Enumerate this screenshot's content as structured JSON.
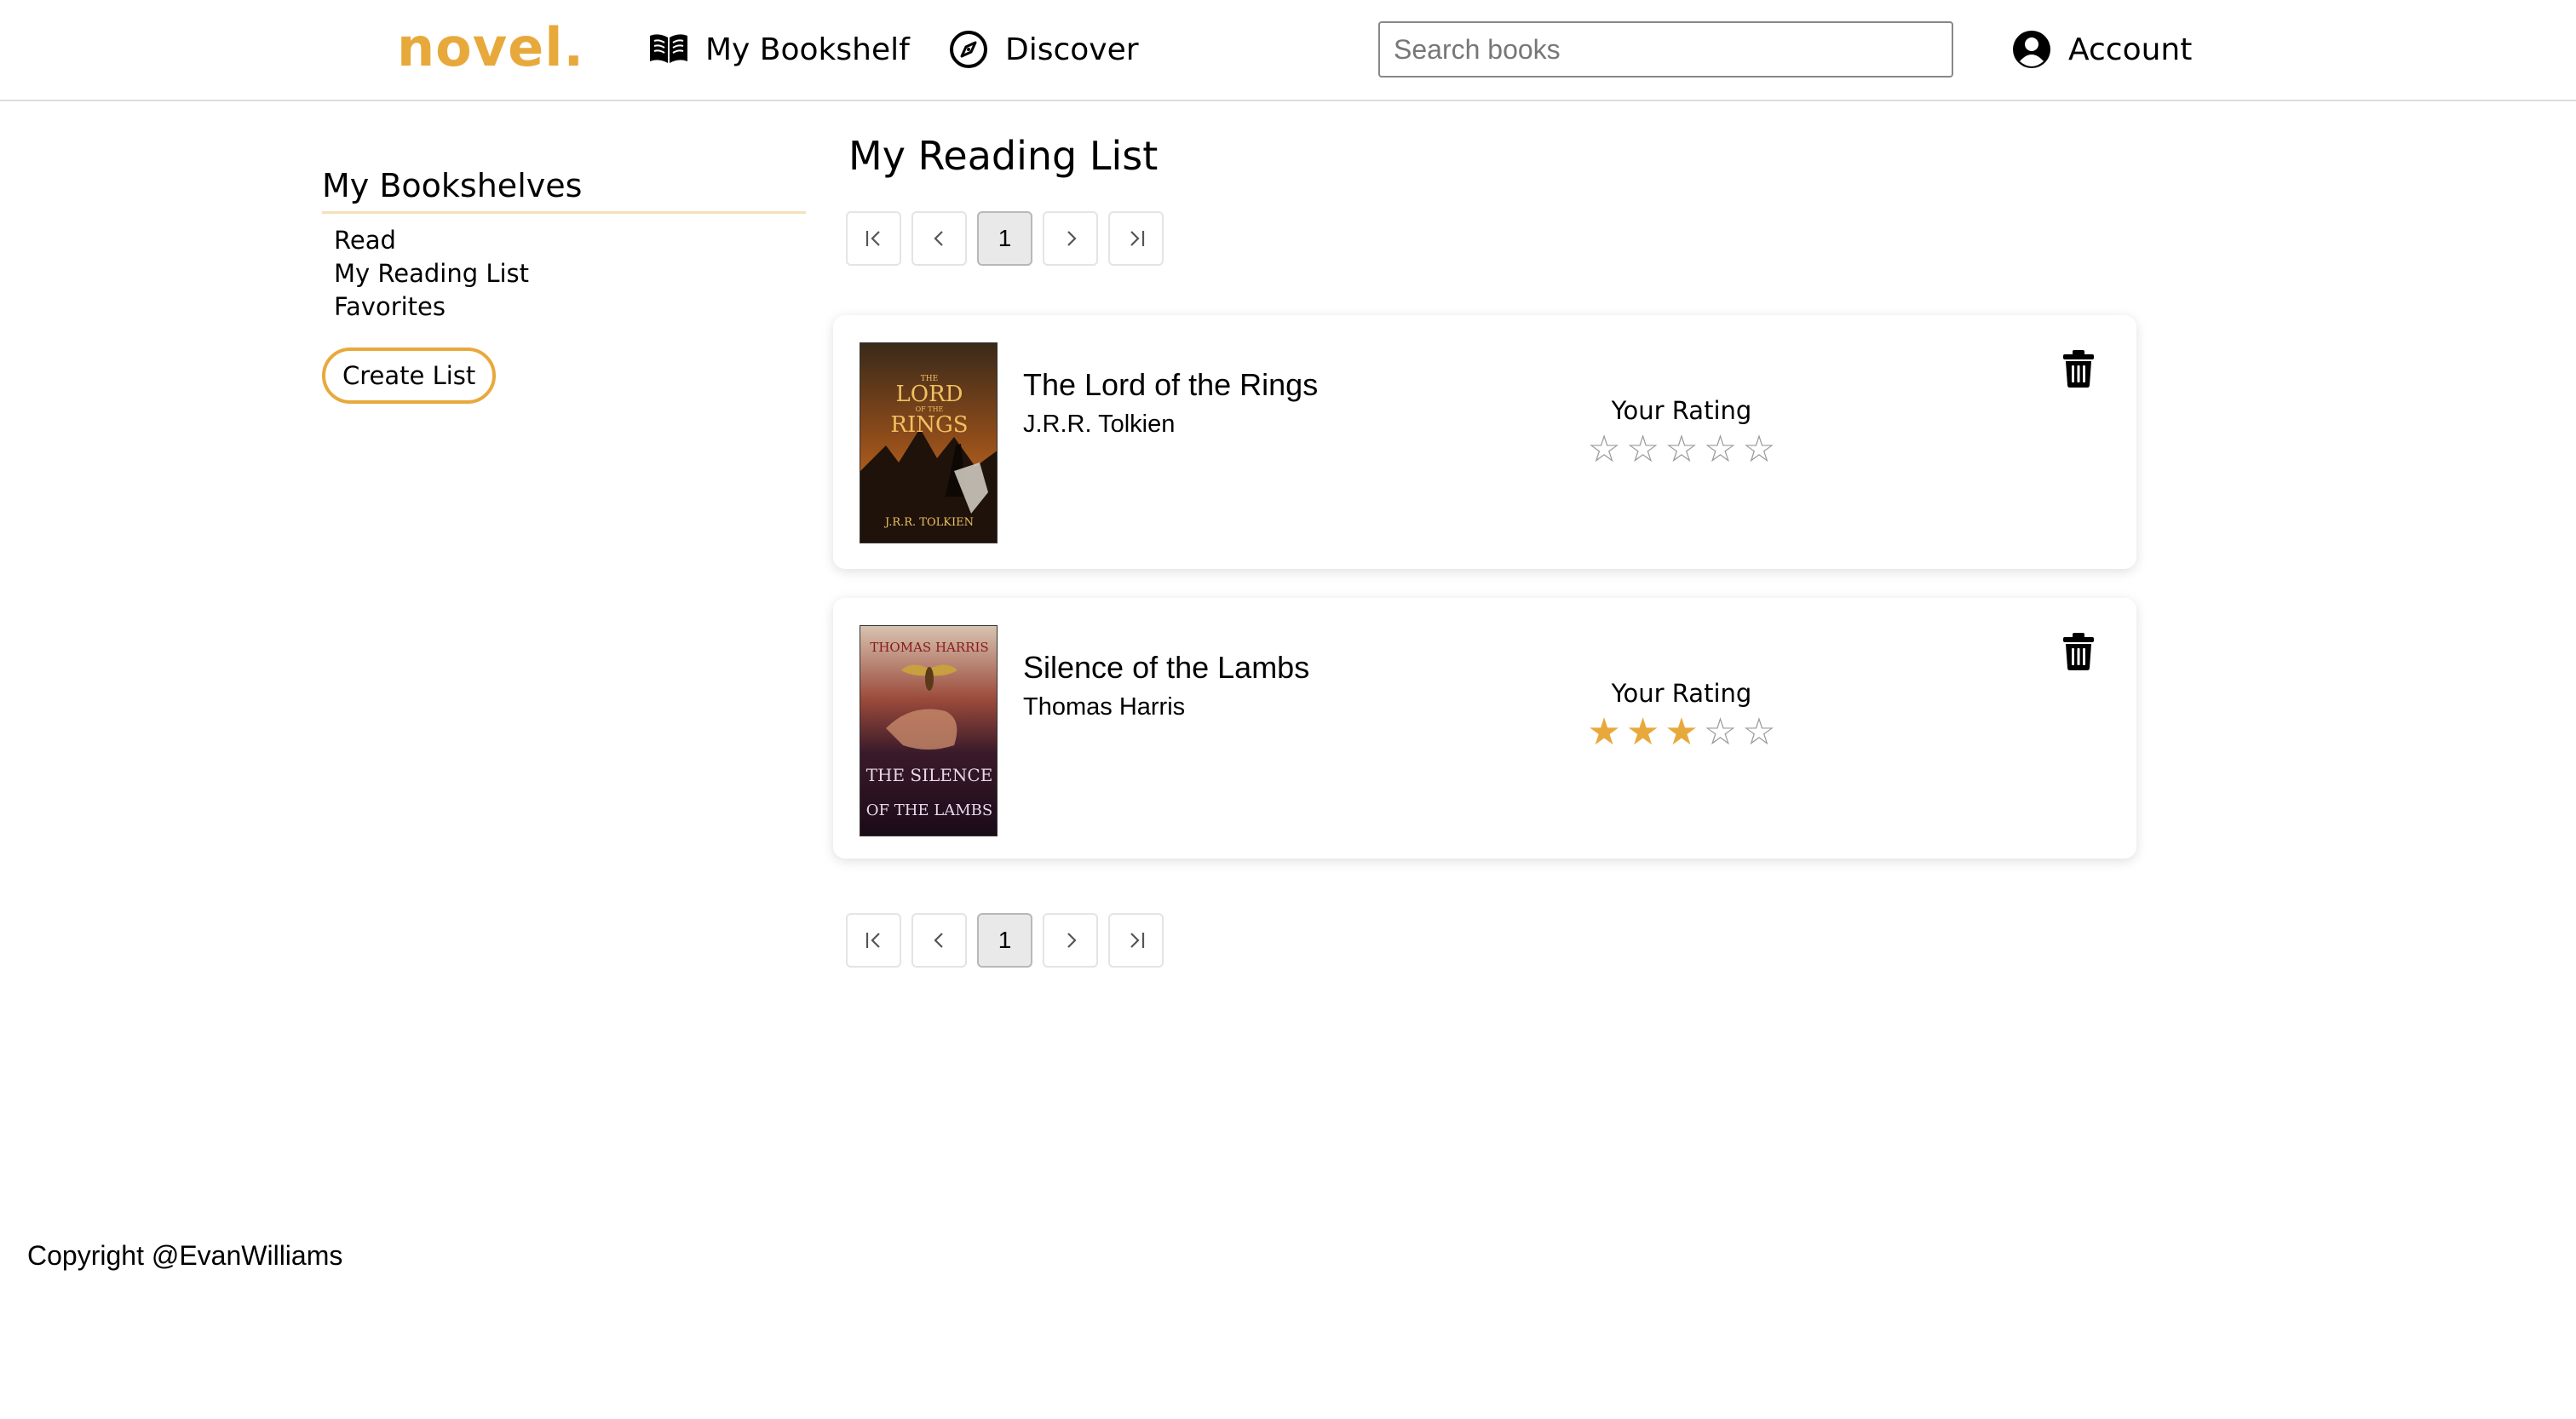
{
  "header": {
    "logo": "novel.",
    "nav": [
      {
        "label": "My Bookshelf",
        "icon": "open-book-icon"
      },
      {
        "label": "Discover",
        "icon": "compass-icon"
      }
    ],
    "search_placeholder": "Search books",
    "account_label": "Account",
    "accent_color": "#e8a93c"
  },
  "sidebar": {
    "title": "My Bookshelves",
    "items": [
      "Read",
      "My Reading List",
      "Favorites"
    ],
    "create_button": "Create List"
  },
  "main": {
    "title": "My Reading List",
    "pagination": {
      "current_page": "1"
    },
    "books": [
      {
        "title": "The Lord of the Rings",
        "author": "J.R.R. Tolkien",
        "rating_label": "Your Rating",
        "rating": 0,
        "max_rating": 5,
        "cover_text": [
          "THE",
          "LORD",
          "OF THE",
          "RINGS",
          "J.R.R. TOLKIEN"
        ]
      },
      {
        "title": "Silence of the Lambs",
        "author": "Thomas Harris",
        "rating_label": "Your Rating",
        "rating": 3,
        "max_rating": 5,
        "cover_text": [
          "THOMAS HARRIS",
          "THE SILENCE",
          "OF THE LAMBS"
        ]
      }
    ]
  },
  "footer": {
    "copyright": "Copyright @EvanWilliams"
  }
}
